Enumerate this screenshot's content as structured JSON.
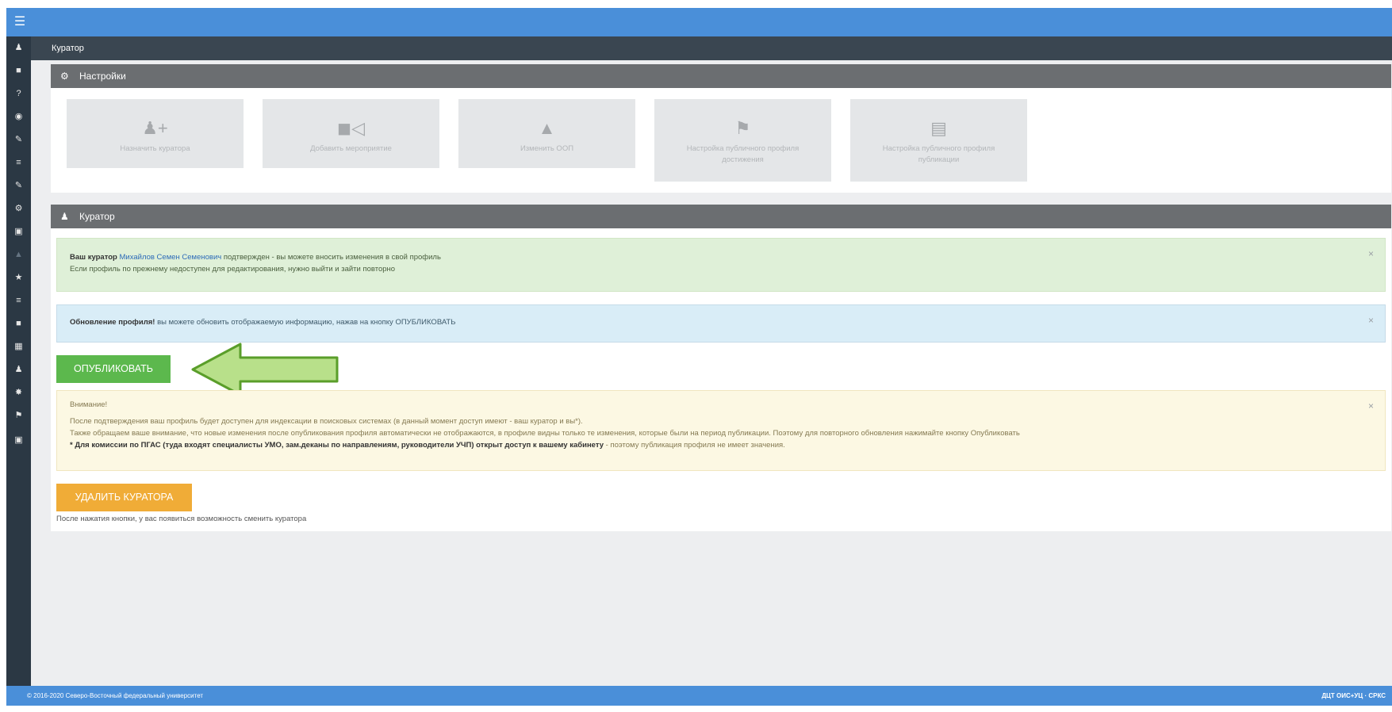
{
  "topbar": {
    "menu_icon": "hamburger-icon"
  },
  "sidebar": {
    "icons": [
      "user-icon",
      "book-icon",
      "question-icon",
      "camera-icon",
      "edit-icon",
      "list-icon",
      "edit-icon",
      "cogs-icon",
      "square-icon",
      "chart-icon",
      "star-icon",
      "list-icon",
      "book-icon",
      "table-icon",
      "user-icon",
      "badge-icon",
      "flag-icon",
      "close-square-icon"
    ]
  },
  "subbar": {
    "title": "Куратор"
  },
  "settings": {
    "title": "Настройки",
    "tiles": [
      {
        "icon": "add-user-icon",
        "label": "Назначить куратора"
      },
      {
        "icon": "bullhorn-icon",
        "label": "Добавить мероприятие"
      },
      {
        "icon": "sitemap-icon",
        "label": "Изменить ООП"
      },
      {
        "icon": "flag-icon",
        "label": "Настройка публичного профиля достижения"
      },
      {
        "icon": "book-icon",
        "label": "Настройка публичного профиля публикации"
      }
    ]
  },
  "curator": {
    "title": "Куратор",
    "success": {
      "prefix": "Ваш куратор",
      "name": "Михайлов Семен Семенович",
      "suffix": "подтвержден - вы можете вносить изменения в свой профиль",
      "line2": "Если профиль по прежнему недоступен для редактирования, нужно выйти и зайти повторно"
    },
    "info": {
      "bold": "Обновление профиля!",
      "text": "вы можете обновить отображаемую информацию, нажав на кнопку ОПУБЛИКОВАТЬ"
    },
    "publish_button": "ОПУБЛИКОВАТЬ",
    "warning": {
      "title": "Внимание!",
      "line1": "После подтверждения ваш профиль будет доступен для индексации в поисковых системах (в данный момент доступ имеют - ваш куратор и вы*).",
      "line2": "Также обращаем ваше внимание, что новые изменения после опубликования профиля автоматически не отображаются, в профиле видны только те изменения, которые были на период публикации. Поэтому для повторного обновления нажимайте кнопку Опубликовать",
      "line3_bold": "* Для комиссии по ПГАС (туда входят специалисты УМО, зам.деканы по направлениям, руководители УЧП) открыт доступ к вашему кабинету",
      "line3_rest": "- поэтому публикация профиля не имеет значения."
    },
    "delete_button": "УДАЛИТЬ КУРАТОРА",
    "delete_note": "После нажатия кнопки, у вас появиться возможность сменить куратора"
  },
  "footer": {
    "left": "© 2016-2020 Северо-Восточный федеральный университет",
    "right": "ДЦТ ОИС+УЦ · СРКС"
  },
  "colors": {
    "topbar": "#4a8fd9",
    "sidebar": "#2b3844",
    "green": "#5cb84d",
    "orange": "#f0ac37",
    "arrow_fill": "#b8e08a",
    "arrow_stroke": "#5a9e2a"
  }
}
